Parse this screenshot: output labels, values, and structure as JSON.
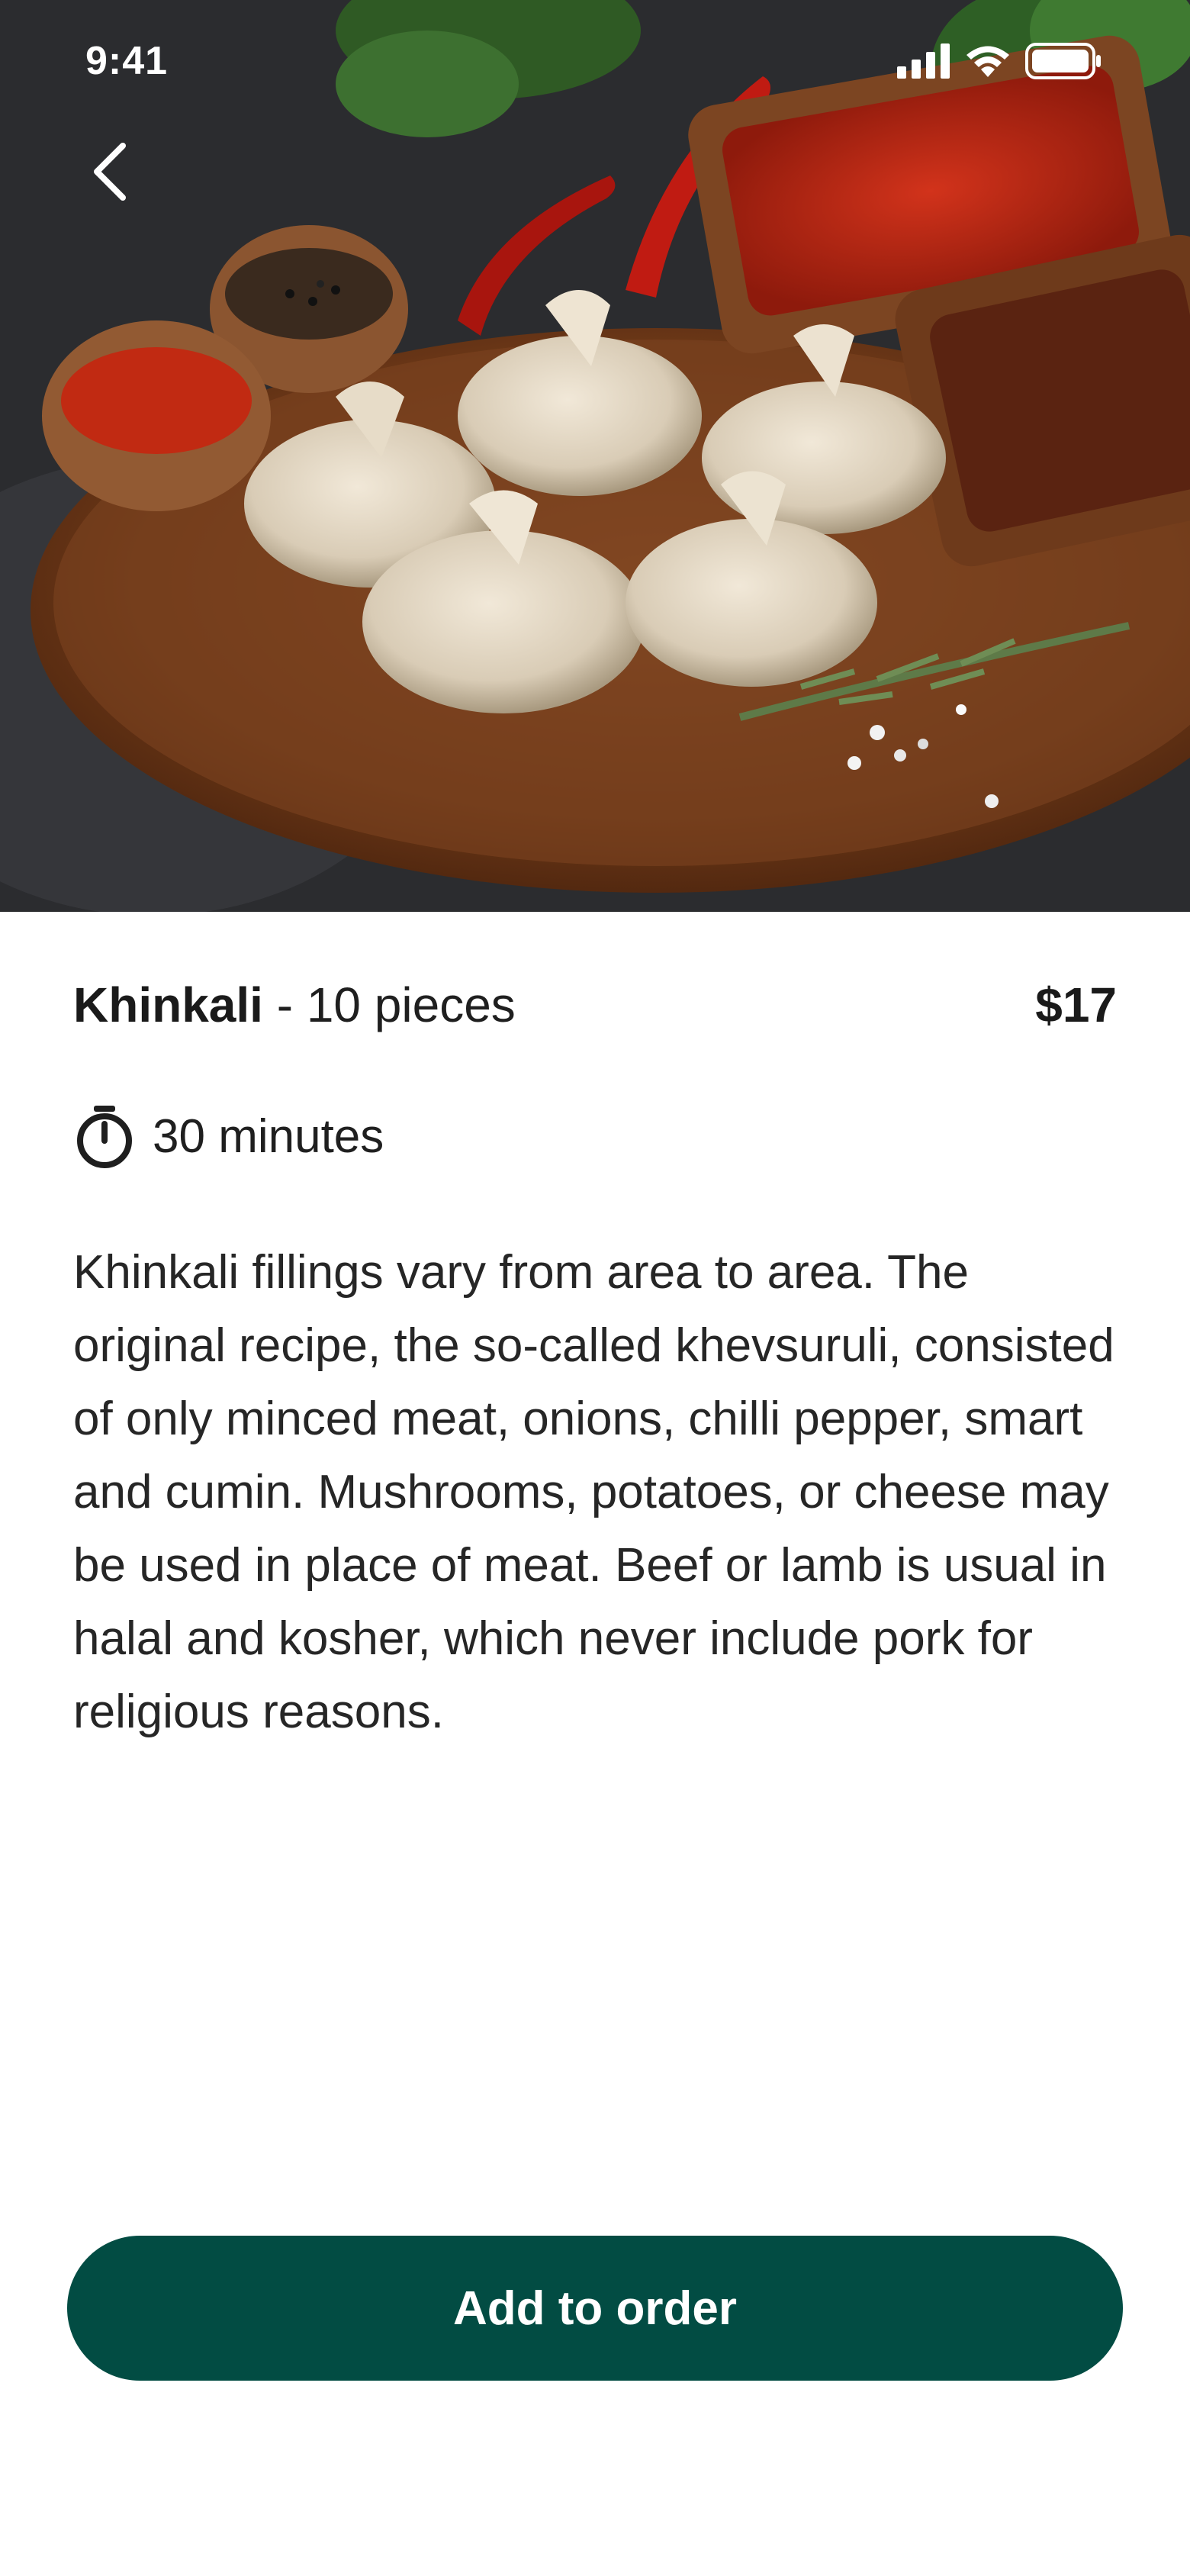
{
  "status_bar": {
    "time": "9:41",
    "icons": [
      "signal-icon",
      "wifi-icon",
      "battery-icon"
    ]
  },
  "nav": {
    "back_icon": "chevron-left-icon"
  },
  "dish": {
    "name": "Khinkali",
    "separator": "-",
    "quantity": "10 pieces",
    "price": "$17",
    "prep_time": "30 minutes",
    "time_icon": "timer-icon",
    "description": "Khinkali fillings vary from area to area. The original recipe, the so-called khevsuruli, consisted of only minced meat, onions, chilli pepper, smart and cumin. Mushrooms, potatoes, or cheese may be used in place of meat. Beef or lamb is usual in halal and kosher, which never include pork for religious reasons."
  },
  "actions": {
    "add_to_order_label": "Add to order"
  },
  "colors": {
    "primary_button": "#024c43",
    "text": "#1f1f1f",
    "background": "#ffffff"
  }
}
